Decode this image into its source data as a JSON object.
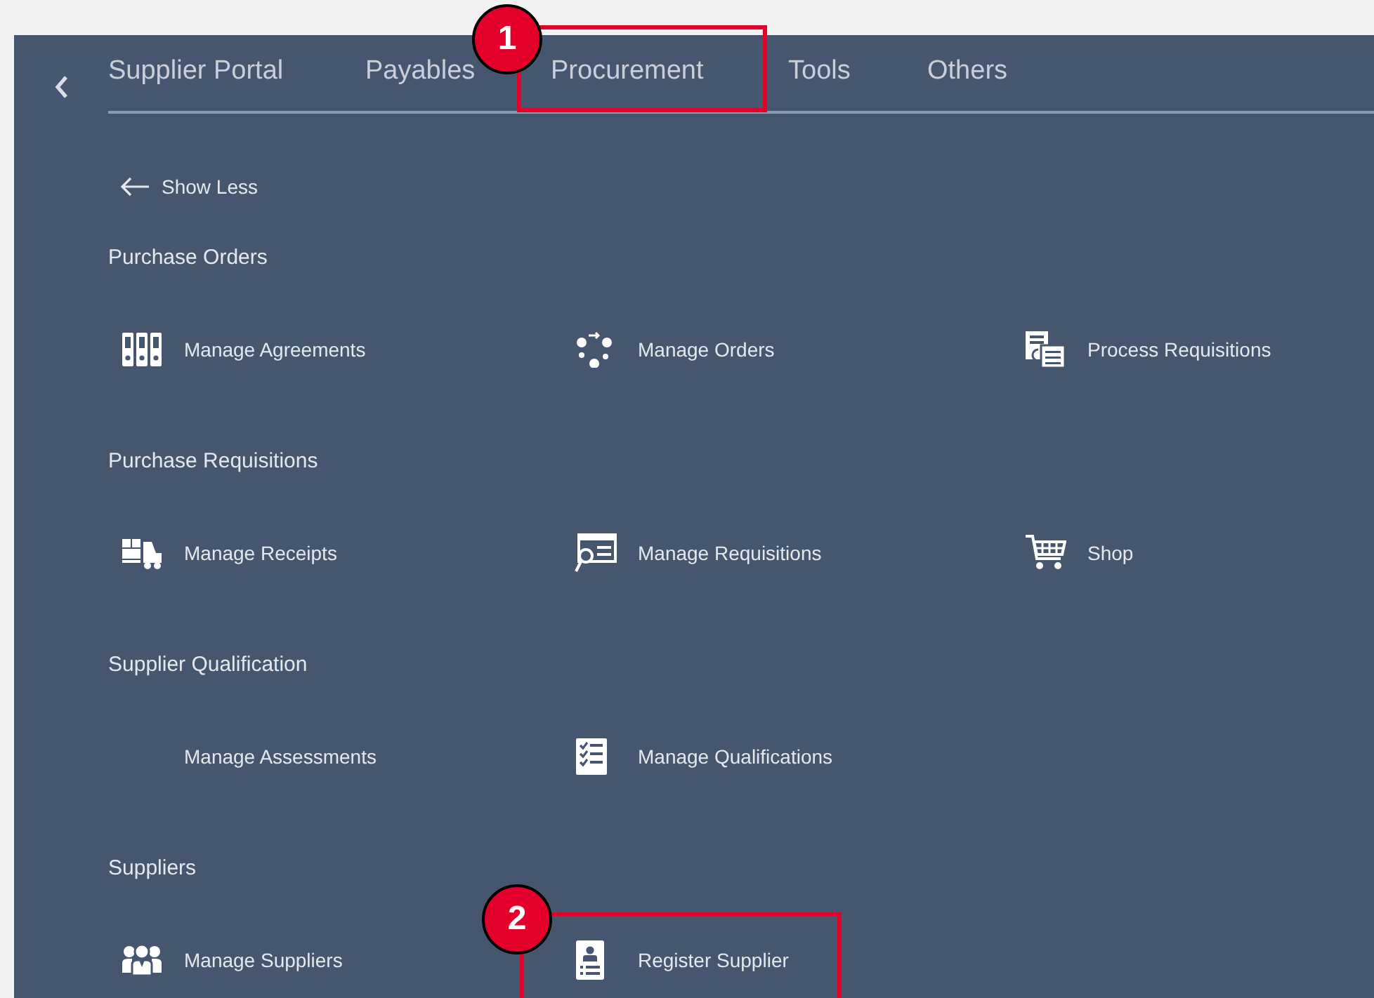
{
  "tabs": [
    {
      "label": "Supplier Portal"
    },
    {
      "label": "Payables"
    },
    {
      "label": "Procurement",
      "callout": "1"
    },
    {
      "label": "Tools"
    },
    {
      "label": "Others"
    }
  ],
  "show_less": "Show Less",
  "sections": [
    {
      "title": "Purchase Orders",
      "items": [
        {
          "label": "Manage Agreements",
          "kind": "binders"
        },
        {
          "label": "Manage Orders",
          "kind": "cycle"
        },
        {
          "label": "Process Requisitions",
          "kind": "documents"
        }
      ]
    },
    {
      "title": "Purchase Requisitions",
      "items": [
        {
          "label": "Manage Receipts",
          "kind": "forklift"
        },
        {
          "label": "Manage Requisitions",
          "kind": "search-form"
        },
        {
          "label": "Shop",
          "kind": "cart"
        }
      ]
    },
    {
      "title": "Supplier Qualification",
      "items": [
        {
          "label": "Manage Assessments",
          "kind": "none"
        },
        {
          "label": "Manage Qualifications",
          "kind": "checklist"
        }
      ]
    },
    {
      "title": "Suppliers",
      "items": [
        {
          "label": "Manage Suppliers",
          "kind": "people"
        },
        {
          "label": "Register Supplier",
          "kind": "badge",
          "callout": "2"
        }
      ]
    }
  ]
}
